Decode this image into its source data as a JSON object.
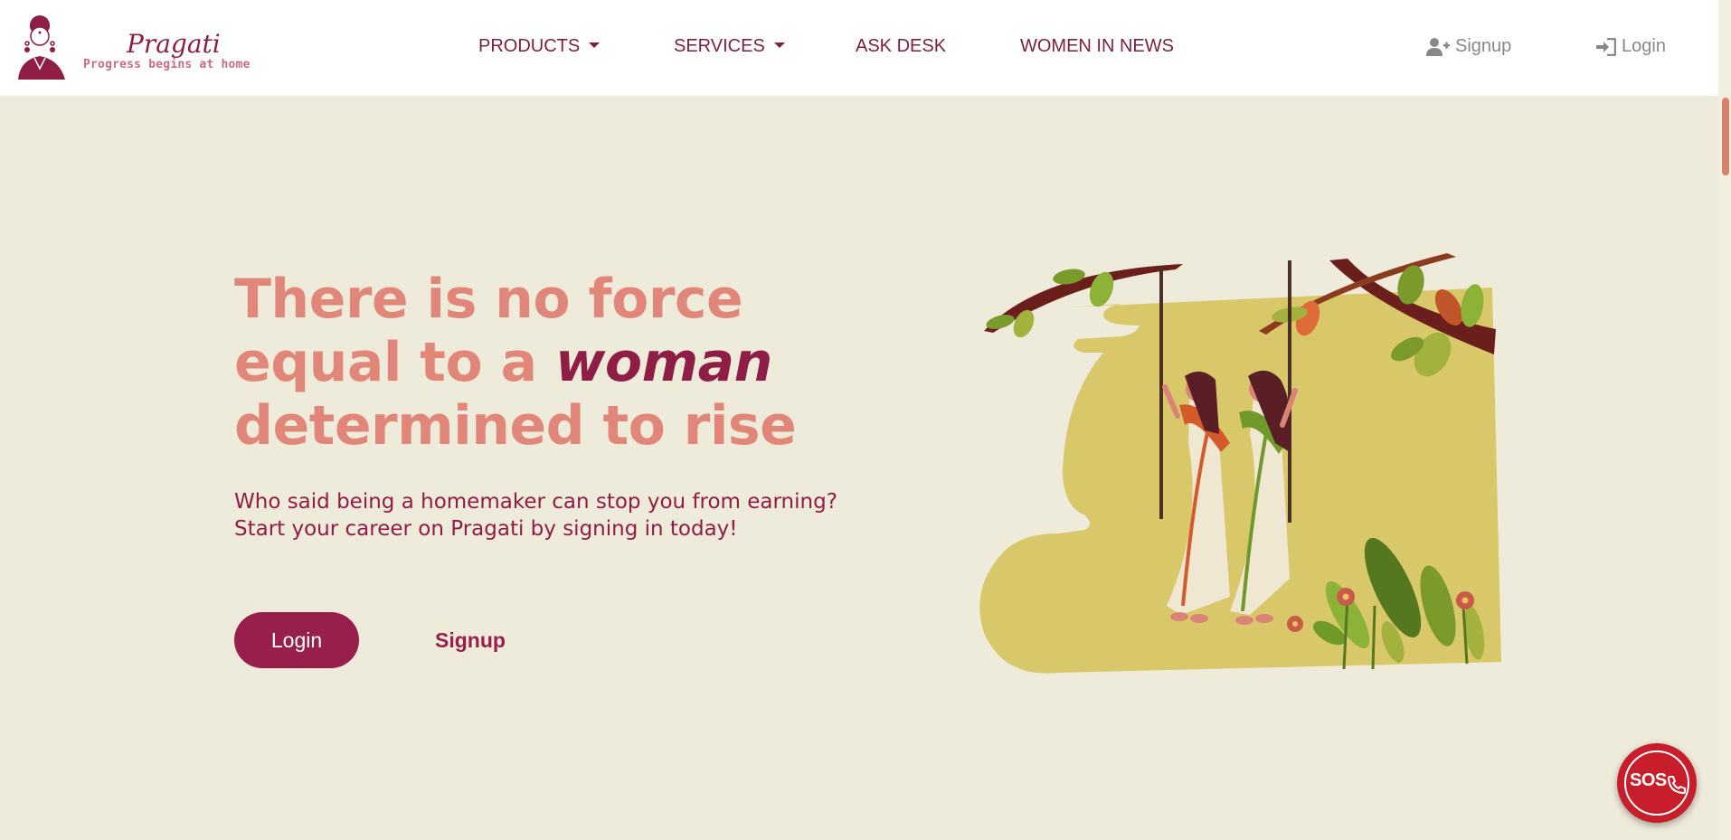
{
  "brand": {
    "name": "Pragati",
    "tagline": "Progress begins at home"
  },
  "nav": {
    "products": "PRODUCTS",
    "services": "SERVICES",
    "ask_desk": "ASK DESK",
    "women_in_news": "WOMEN IN NEWS",
    "signup": "Signup",
    "login": "Login"
  },
  "hero": {
    "title_part1": "There is no force equal to a",
    "title_emphasis": "woman",
    "title_part2": "determined to rise",
    "subtitle_line1": "Who said being a homemaker can stop you from earning?",
    "subtitle_line2": "Start your career on Pragati by signing in today!",
    "login_button": "Login",
    "signup_button": "Signup"
  },
  "sos": {
    "label": "SOS"
  },
  "colors": {
    "brand": "#8e1e45",
    "accent": "#e0877a",
    "background": "#efebdb",
    "button": "#981e4b",
    "sos": "#c81d2b"
  },
  "icons": [
    "user-plus-icon",
    "sign-in-icon",
    "phone-icon"
  ]
}
